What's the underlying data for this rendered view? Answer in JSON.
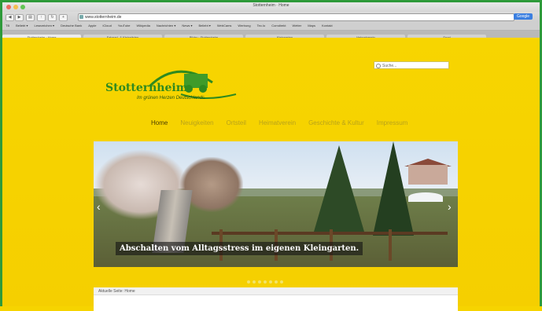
{
  "browser": {
    "window_title": "Stotternheim · Home",
    "url": "www.stotternheim.de",
    "search_button": "Google",
    "bookmarks": [
      "TB",
      "Beliebt ▾",
      "Lesezeichen ▾",
      "Deutsche Bank",
      "Apple",
      "iCloud",
      "YouTube",
      "Wikipedia",
      "Nachrichten ▾",
      "News ▾",
      "Beliebt ▾",
      "WebCams",
      "Werbung",
      "Tec.Io",
      "Comdirekt",
      "Wetter",
      "Maps",
      "Kontakt"
    ],
    "tabs": [
      "Stotternheim · Home",
      "Fahrrad- & Kleingärten",
      "Bilder · Stotternheim",
      "Kleingarten",
      "Heimatverein",
      "Sport"
    ]
  },
  "site": {
    "logo_name": "Stotternheim",
    "tagline": "Im grünen Herzen Deutschlands.",
    "search_placeholder": "Suche...",
    "nav": [
      "Home",
      "Neuigkeiten",
      "Ortsteil",
      "Heimatverein",
      "Geschichte & Kultur",
      "Impressum"
    ],
    "active_nav": "Home",
    "slider_caption": "Abschalten vom Alltagsstress im eigenen Kleingarten.",
    "slider_dots": 7,
    "breadcrumb": "Aktuelle Seite: Home"
  }
}
